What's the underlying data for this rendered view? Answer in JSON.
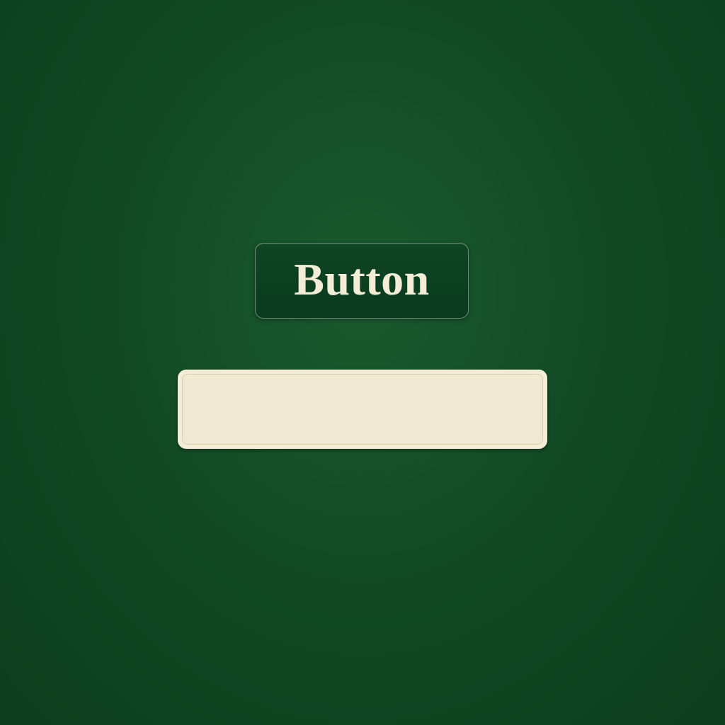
{
  "button": {
    "label": "Button"
  },
  "text_field": {
    "value": "",
    "placeholder": ""
  },
  "colors": {
    "background": "#124a25",
    "button_fill": "#0b3a1e",
    "button_text": "#f3ecd6",
    "field_fill": "#f3ecd6"
  }
}
